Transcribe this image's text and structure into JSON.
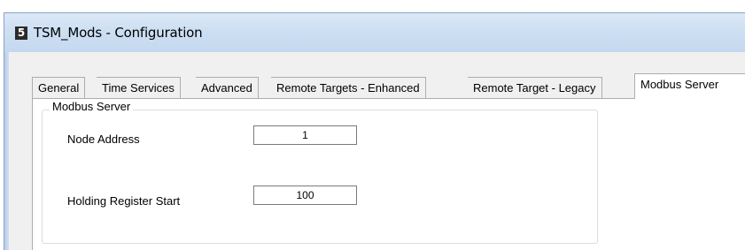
{
  "window": {
    "title": "TSM_Mods - Configuration",
    "icon": "app-logo-icon",
    "icon_glyph": "5"
  },
  "tabs": [
    {
      "label": "General",
      "selected": false
    },
    {
      "label": "Time Services",
      "selected": false
    },
    {
      "label": "Advanced",
      "selected": false
    },
    {
      "label": "Remote Targets - Enhanced",
      "selected": false
    },
    {
      "label": "Remote Target - Legacy",
      "selected": false
    },
    {
      "label": "Modbus Server",
      "selected": true
    }
  ],
  "modbus_server": {
    "group_title": "Modbus Server",
    "fields": [
      {
        "label": "Node Address",
        "value": "1"
      },
      {
        "label": "Holding Register Start",
        "value": "100"
      }
    ]
  },
  "colors": {
    "titlebar": "#cddff2",
    "client_background": "#f0f0f0",
    "panel_background": "#ffffff"
  }
}
